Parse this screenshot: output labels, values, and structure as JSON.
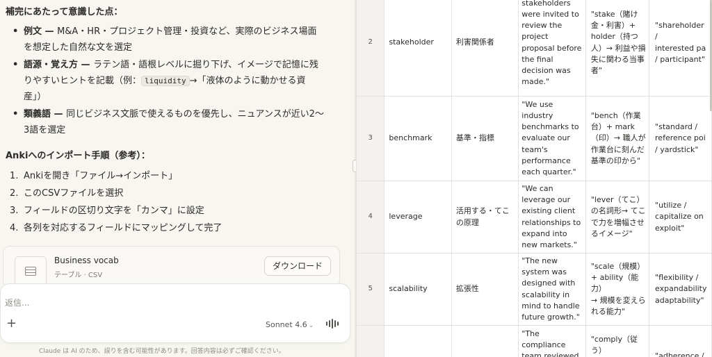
{
  "chat": {
    "section1_title": "補完にあたって意識した点：",
    "bullets": [
      {
        "term": "例文 — ",
        "lines": [
          "M&A・HR・プロジェクト管理・投資など、実際のビジネス場面",
          "を想定した自然な文を選定"
        ]
      },
      {
        "term": "語源・覚え方 — ",
        "line1": "ラテン語・語根レベルに掘り下げ、イメージで記憶に残",
        "line2_pre": "りやすいヒントを記載（例：",
        "code": "liquidity",
        "line2_post": "→「液体のように動かせる資",
        "line3": "産」）"
      },
      {
        "term": "類義語 — ",
        "lines": [
          "同じビジネス文脈で使えるものを優先し、ニュアンスが近い2〜",
          "3語を選定"
        ]
      }
    ],
    "section2_title": "Ankiへのインポート手順（参考）：",
    "steps": [
      {
        "num": "1.",
        "text": "Ankiを開き「ファイル→インポート」"
      },
      {
        "num": "2.",
        "text": "このCSVファイルを選択"
      },
      {
        "num": "3.",
        "text": "フィールドの区切り文字を「カンマ」に設定"
      },
      {
        "num": "4.",
        "text": "各列を対応するフィールドにマッピングして完了"
      }
    ],
    "file": {
      "name": "Business vocab",
      "meta": "テーブル · CSV",
      "download_label": "ダウンロード"
    },
    "input": {
      "placeholder": "返信...",
      "model": "Sonnet 4.6"
    },
    "disclaimer": "Claude は AI のため、誤りを含む可能性があります。回答内容は必ずご確認ください。"
  },
  "table": {
    "rows": [
      {
        "num": "2",
        "word": "stakeholder",
        "ja": "利害関係者",
        "example": "stakeholders\nwere invited to\nreview the\nproject\nproposal before\nthe final\ndecision was\nmade.\"",
        "etymology": "\"stake（賭け\n金・利害）+\nholder（持つ\n人）→ 利益や損\n失に関わる当事\n者\"",
        "synonyms": "\"shareholder /\ninterested pa\n/ participant\""
      },
      {
        "num": "3",
        "word": "benchmark",
        "ja": "基準・指標",
        "example": "\"We use\nindustry\nbenchmarks to\nevaluate our\nteam's\nperformance\neach quarter.\"",
        "etymology": "\"bench（作業\n台）+ mark\n（印）→ 職人が\n作業台に刻んだ\n基準の印から\"",
        "synonyms": "\"standard /\nreference poi\n/ yardstick\""
      },
      {
        "num": "4",
        "word": "leverage",
        "ja": "活用する・てこ\nの原理",
        "example": "\"We can\nleverage our\nexisting client\nrelationships to\nexpand into\nnew markets.\"",
        "etymology": "\"lever（てこ）\nの名詞形→ てこ\nで力を増幅させ\nるイメージ\"",
        "synonyms": "\"utilize /\ncapitalize on\nexploit\""
      },
      {
        "num": "5",
        "word": "scalability",
        "ja": "拡張性",
        "example": "\"The new\nsystem was\ndesigned with\nscalability in\nmind to handle\nfuture growth.\"",
        "etymology": "\"scale（規模）\n+ ability（能力）\n→ 規模を変えら\nれる能力\"",
        "synonyms": "\"flexibility /\nexpandability\nadaptability\""
      },
      {
        "num": "",
        "word": "",
        "ja": "",
        "example": "\"The\ncompliance\nteam reviewed",
        "etymology": "\"comply（従う）\nの名詞形→",
        "synonyms": "\"adherence /"
      }
    ]
  }
}
